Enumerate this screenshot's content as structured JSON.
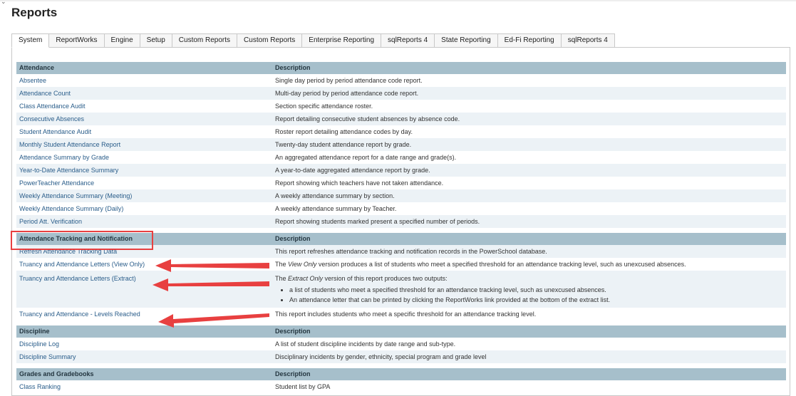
{
  "page": {
    "title": "Reports"
  },
  "tabs": [
    "System",
    "ReportWorks",
    "Engine",
    "Setup",
    "Custom Reports",
    "Custom Reports",
    "Enterprise Reporting",
    "sqlReports 4",
    "State Reporting",
    "Ed-Fi Reporting",
    "sqlReports 4"
  ],
  "sections": [
    {
      "name": "Attendance",
      "desc_header": "Description",
      "rows": [
        {
          "name": "Absentee",
          "desc": "Single day period by period attendance code report."
        },
        {
          "name": "Attendance Count",
          "desc": "Multi-day period by period attendance code report."
        },
        {
          "name": "Class Attendance Audit",
          "desc": "Section specific attendance roster."
        },
        {
          "name": "Consecutive Absences",
          "desc": "Report detailing consecutive student absences by absence code."
        },
        {
          "name": "Student Attendance Audit",
          "desc": "Roster report detailing attendance codes by day."
        },
        {
          "name": "Monthly Student Attendance Report",
          "desc": "Twenty-day student attendance report by grade."
        },
        {
          "name": "Attendance Summary by Grade",
          "desc": "An aggregated attendance report for a date range and grade(s)."
        },
        {
          "name": "Year-to-Date Attendance Summary",
          "desc": "A year-to-date aggregated attendance report by grade."
        },
        {
          "name": "PowerTeacher Attendance",
          "desc": "Report showing which teachers have not taken attendance."
        },
        {
          "name": "Weekly Attendance Summary (Meeting)",
          "desc": "A weekly attendance summary by section."
        },
        {
          "name": "Weekly Attendance Summary (Daily)",
          "desc": "A weekly attendance summary by Teacher."
        },
        {
          "name": "Period Att. Verification",
          "desc": "Report showing students marked present a specified number of periods."
        }
      ]
    },
    {
      "name": "Attendance Tracking and Notification",
      "desc_header": "Description",
      "rows": [
        {
          "name": "Refresh Attendance Tracking Data",
          "desc": "This report refreshes attendance tracking and notification records in the PowerSchool database."
        },
        {
          "name": "Truancy and Attendance Letters (View Only)",
          "desc_pre": "The ",
          "desc_em": "View Only",
          "desc_post": " version produces a list of students who meet a specified threshold for an attendance tracking level, such as unexcused absences."
        },
        {
          "name": "Truancy and Attendance Letters (Extract)",
          "desc_pre": "The ",
          "desc_em": "Extract Only",
          "desc_post": " version of this report produces two outputs:",
          "bullets": [
            "a list of students who meet a specified threshold for an attendance tracking level, such as unexcused absences.",
            "An attendance letter that can be printed by clicking the ReportWorks link provided at the bottom of the extract list."
          ]
        },
        {
          "name": "Truancy and Attendance - Levels Reached",
          "desc": "This report includes students who meet a specific threshold for an attendance tracking level."
        }
      ]
    },
    {
      "name": "Discipline",
      "desc_header": "Description",
      "rows": [
        {
          "name": "Discipline Log",
          "desc": "A list of student discipline incidents by date range and sub-type."
        },
        {
          "name": "Discipline Summary",
          "desc": "Disciplinary incidents by gender, ethnicity, special program and grade level"
        }
      ]
    },
    {
      "name": "Grades and Gradebooks",
      "desc_header": "Description",
      "rows": [
        {
          "name": "Class Ranking",
          "desc": "Student list by GPA"
        }
      ]
    }
  ],
  "annotation_color": "#e84040"
}
